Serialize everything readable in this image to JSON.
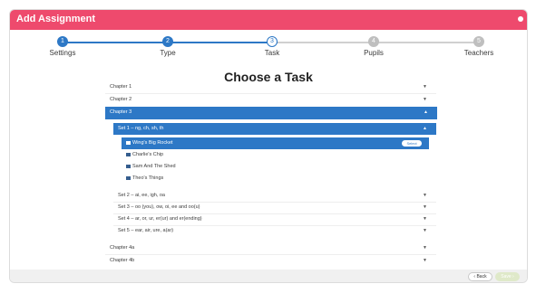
{
  "modal": {
    "title": "Add Assignment",
    "heading": "Choose a Task"
  },
  "colors": {
    "header": "#ee4a6d",
    "accent": "#2d78c6"
  },
  "stepper": [
    {
      "number": "1",
      "label": "Settings",
      "state": "done"
    },
    {
      "number": "2",
      "label": "Type",
      "state": "done"
    },
    {
      "number": "3",
      "label": "Task",
      "state": "current"
    },
    {
      "number": "4",
      "label": "Pupils",
      "state": "todo"
    },
    {
      "number": "5",
      "label": "Teachers",
      "state": "todo"
    }
  ],
  "chapters": {
    "chapter1": "Chapter 1",
    "chapter2": "Chapter 2",
    "chapter3": "Chapter 3",
    "chapter4a": "Chapter 4a",
    "chapter4b": "Chapter 4b"
  },
  "sets": {
    "set1": "Set 1 – ng, ch, sh, th",
    "set2": "Set 2 – ai, ee, igh, oa",
    "set3": "Set 3 – oo (you), ow, oi, ee and oo(u)",
    "set4": "Set 4 – ar, or, ur, er(ur) and er(ending)",
    "set5": "Set 5 – ear, air, ure, a(ar)"
  },
  "books": {
    "book1": "Wing's Big Rocket",
    "book2": "Charlie's Chip",
    "book3": "Sam And The Shed",
    "book4": "Theo's Things"
  },
  "select_label": "Select",
  "footer": {
    "back_label": "‹ Back",
    "save_label": "Save ›"
  }
}
